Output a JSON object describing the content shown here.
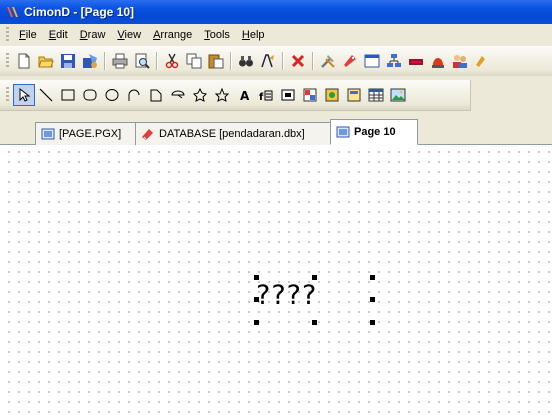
{
  "window": {
    "title": "CimonD - [Page 10]"
  },
  "menu": [
    {
      "underline": "F",
      "rest": "ile"
    },
    {
      "underline": "E",
      "rest": "dit"
    },
    {
      "underline": "D",
      "rest": "raw"
    },
    {
      "underline": "V",
      "rest": "iew"
    },
    {
      "underline": "A",
      "rest": "rrange"
    },
    {
      "underline": "T",
      "rest": "ools"
    },
    {
      "underline": "H",
      "rest": "elp"
    }
  ],
  "tabs": [
    {
      "label": "[PAGE.PGX]",
      "icon": "page-icon"
    },
    {
      "label": "DATABASE [pendadaran.dbx]",
      "icon": "database-icon"
    },
    {
      "label": "Page 10",
      "icon": "page-icon",
      "active": true
    }
  ],
  "canvas": {
    "text_object": "????"
  },
  "colors": {
    "titlebar": "#0a53e0",
    "face": "#ece9d8",
    "selection": "#316ac5"
  }
}
